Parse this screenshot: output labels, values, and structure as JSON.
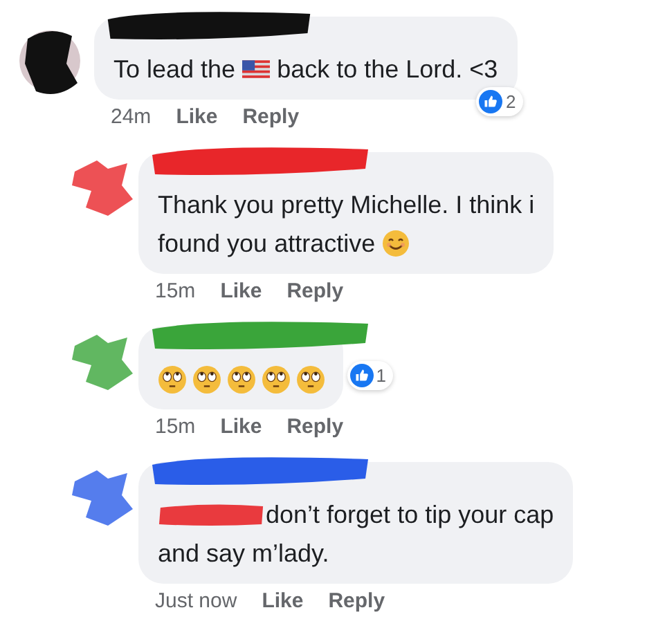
{
  "comments": [
    {
      "reply": false,
      "color": "#111111",
      "lines": [
        [
          {
            "kind": "text",
            "text": "To lead the"
          },
          {
            "kind": "flag"
          },
          {
            "kind": "text",
            "text": "back to the Lord. <3"
          }
        ]
      ],
      "reactions": "2",
      "time": "24m",
      "actions": [
        "Like",
        "Reply"
      ]
    },
    {
      "reply": true,
      "color": "#e8262a",
      "lines": [
        [
          {
            "kind": "text",
            "text": "Thank you pretty Michelle. I think i"
          }
        ],
        [
          {
            "kind": "text",
            "text": "found you attractive"
          },
          {
            "kind": "smile"
          }
        ]
      ],
      "time": "15m",
      "actions": [
        "Like",
        "Reply"
      ]
    },
    {
      "reply": true,
      "color": "#3aa53a",
      "lines": [
        [
          {
            "kind": "eyeroll"
          },
          {
            "kind": "eyeroll"
          },
          {
            "kind": "eyeroll"
          },
          {
            "kind": "eyeroll"
          },
          {
            "kind": "eyeroll"
          }
        ]
      ],
      "reactions": "1",
      "time": "15m",
      "actions": [
        "Like",
        "Reply"
      ]
    },
    {
      "reply": true,
      "color": "#2a5de8",
      "lines": [
        [
          {
            "kind": "mention"
          },
          {
            "kind": "text",
            "text": "don’t forget to tip your cap"
          }
        ],
        [
          {
            "kind": "text",
            "text": "and say m’lady."
          }
        ]
      ],
      "time": "Just now",
      "actions": [
        "Like",
        "Reply"
      ]
    }
  ]
}
